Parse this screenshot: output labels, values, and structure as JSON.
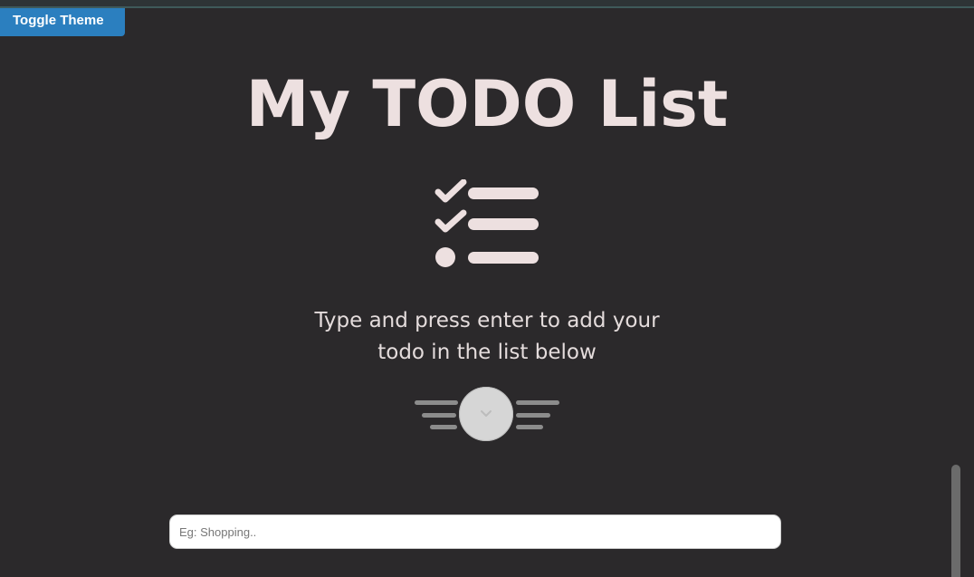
{
  "header": {
    "toggle_label": "Toggle Theme"
  },
  "main": {
    "title": "My TODO List",
    "subtitle_line1": "Type and press enter to add your",
    "subtitle_line2": "todo in the list below"
  },
  "input": {
    "placeholder": "Eg: Shopping..",
    "value": ""
  },
  "icons": {
    "hero": "checklist-icon",
    "scroll": "chevron-down-icon"
  },
  "colors": {
    "background": "#2b292b",
    "toggle_button": "#2b7fbf",
    "title_text": "#ede0e0"
  }
}
